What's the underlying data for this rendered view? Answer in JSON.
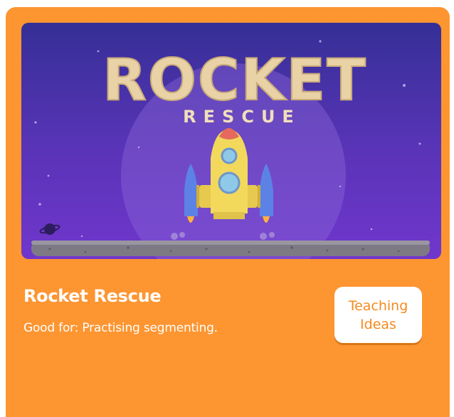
{
  "card": {
    "title": "Rocket Rescue",
    "good_for": "Good for: Practising segmenting.",
    "button_label": "Teaching Ideas",
    "accent_color": "#fd9531"
  },
  "thumbnail": {
    "logo_title": "ROCKET",
    "logo_subtitle": "RESCUE",
    "icons": [
      "rocket-icon",
      "planet-icon"
    ]
  }
}
